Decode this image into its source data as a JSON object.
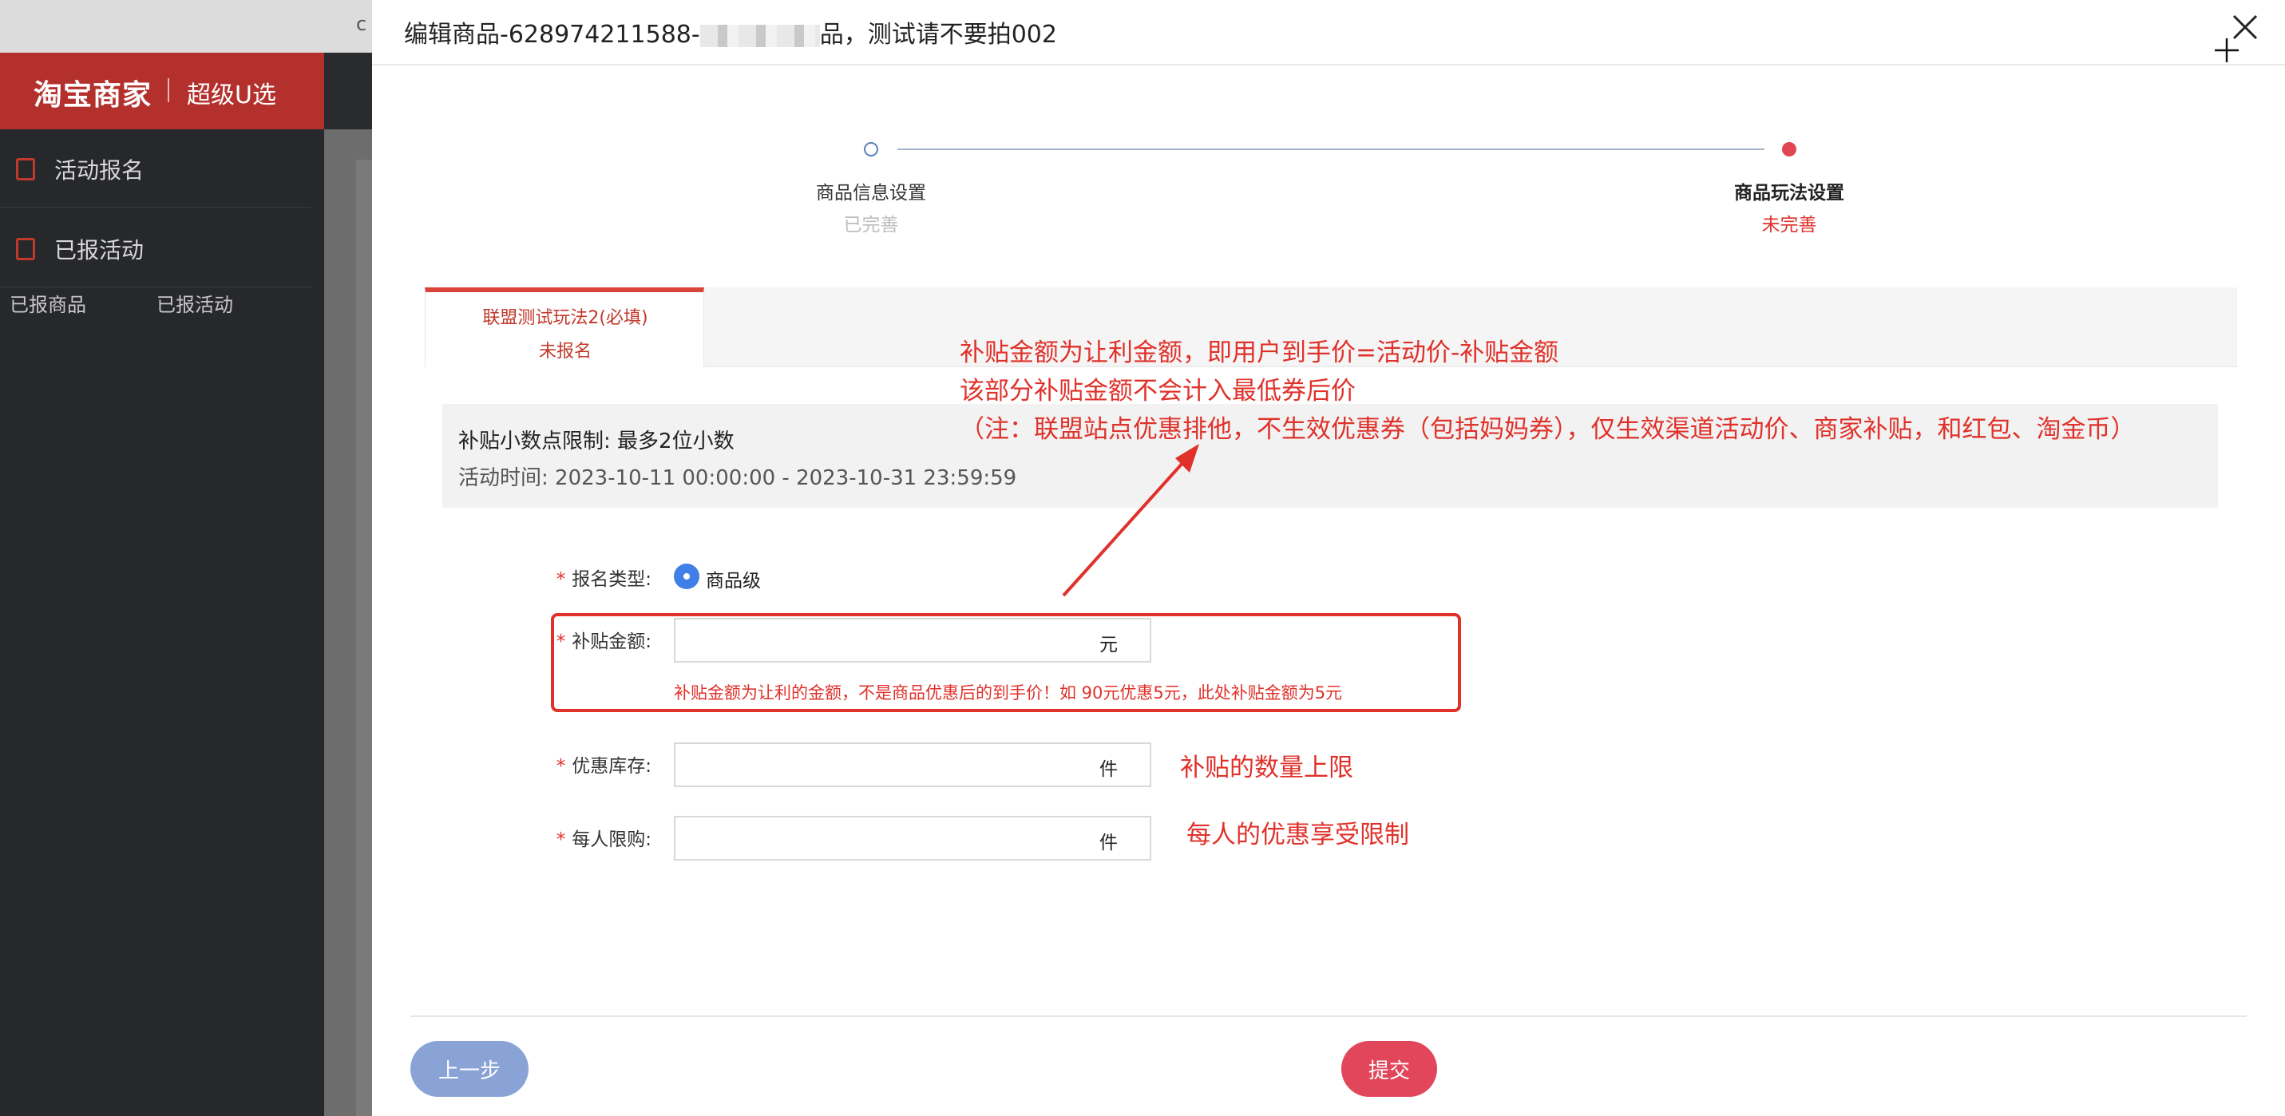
{
  "app": {
    "crumb": "c",
    "brand": "淘宝商家",
    "brand_sub": "超级U选",
    "menu": [
      {
        "label": "活动报名",
        "icon": "form-icon"
      },
      {
        "label": "已报活动",
        "icon": "list-icon"
      }
    ],
    "submenu": [
      "已报商品",
      "已报活动"
    ]
  },
  "modal": {
    "title_prefix": "编辑商品-628974211588-",
    "title_suffix": "品，测试请不要拍002"
  },
  "steps": [
    {
      "title": "商品信息设置",
      "status": "已完善"
    },
    {
      "title": "商品玩法设置",
      "status": "未完善"
    }
  ],
  "tab": {
    "name": "联盟测试玩法2(必填)",
    "status": "未报名"
  },
  "info": {
    "decimal_limit": "补贴小数点限制: 最多2位小数",
    "time": "活动时间: 2023-10-11 00:00:00 - 2023-10-31 23:59:59"
  },
  "form": {
    "required_mark": "*",
    "type_label": "报名类型:",
    "type_option": "商品级",
    "amount_label": "补贴金额:",
    "amount_unit": "元",
    "amount_value": "",
    "amount_hint": "补贴金额为让利的金额，不是商品优惠后的到手价！如 90元优惠5元，此处补贴金额为5元",
    "stock_label": "优惠库存:",
    "stock_unit": "件",
    "stock_value": "",
    "limit_label": "每人限购:",
    "limit_unit": "件",
    "limit_value": ""
  },
  "annotations": {
    "line1": "补贴金额为让利金额，即用户到手价=活动价-补贴金额",
    "line2": "该部分补贴金额不会计入最低券后价",
    "line3": "（注：联盟站点优惠排他，不生效优惠券（包括妈妈券），仅生效渠道活动价、商家补贴，和红包、淘金币）",
    "stock_note": "补贴的数量上限",
    "limit_note": "每人的优惠享受限制"
  },
  "footer": {
    "prev_label": "上一步",
    "submit_label": "提交"
  },
  "colors": {
    "accent_red": "#e0312a",
    "brand_red": "#b3302c",
    "primary_blue": "#3f7fe6",
    "submit_pink": "#e2465a",
    "prev_blue": "#8aa3d6"
  }
}
